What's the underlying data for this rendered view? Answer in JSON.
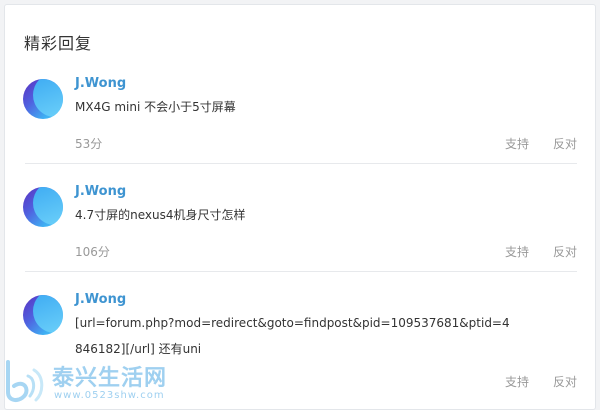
{
  "section_title": "精彩回复",
  "replies": [
    {
      "author": "J.Wong",
      "content": "MX4G mini 不会小于5寸屏幕",
      "time": "53分",
      "support": "支持",
      "oppose": "反对"
    },
    {
      "author": "J.Wong",
      "content": "4.7寸屏的nexus4机身尺寸怎样",
      "time": "106分",
      "support": "支持",
      "oppose": "反对"
    },
    {
      "author": "J.Wong",
      "content": "[url=forum.php?mod=redirect&goto=findpost&pid=109537681&ptid=4846182][/url] 还有uni",
      "time": "",
      "support": "支持",
      "oppose": "反对"
    }
  ],
  "watermark": {
    "name": "泰兴生活网",
    "url": "www.0523shw.com"
  },
  "colors": {
    "author": "#3e94d1",
    "muted": "#999999",
    "text": "#333333",
    "watermark": "#9fd0f0"
  }
}
